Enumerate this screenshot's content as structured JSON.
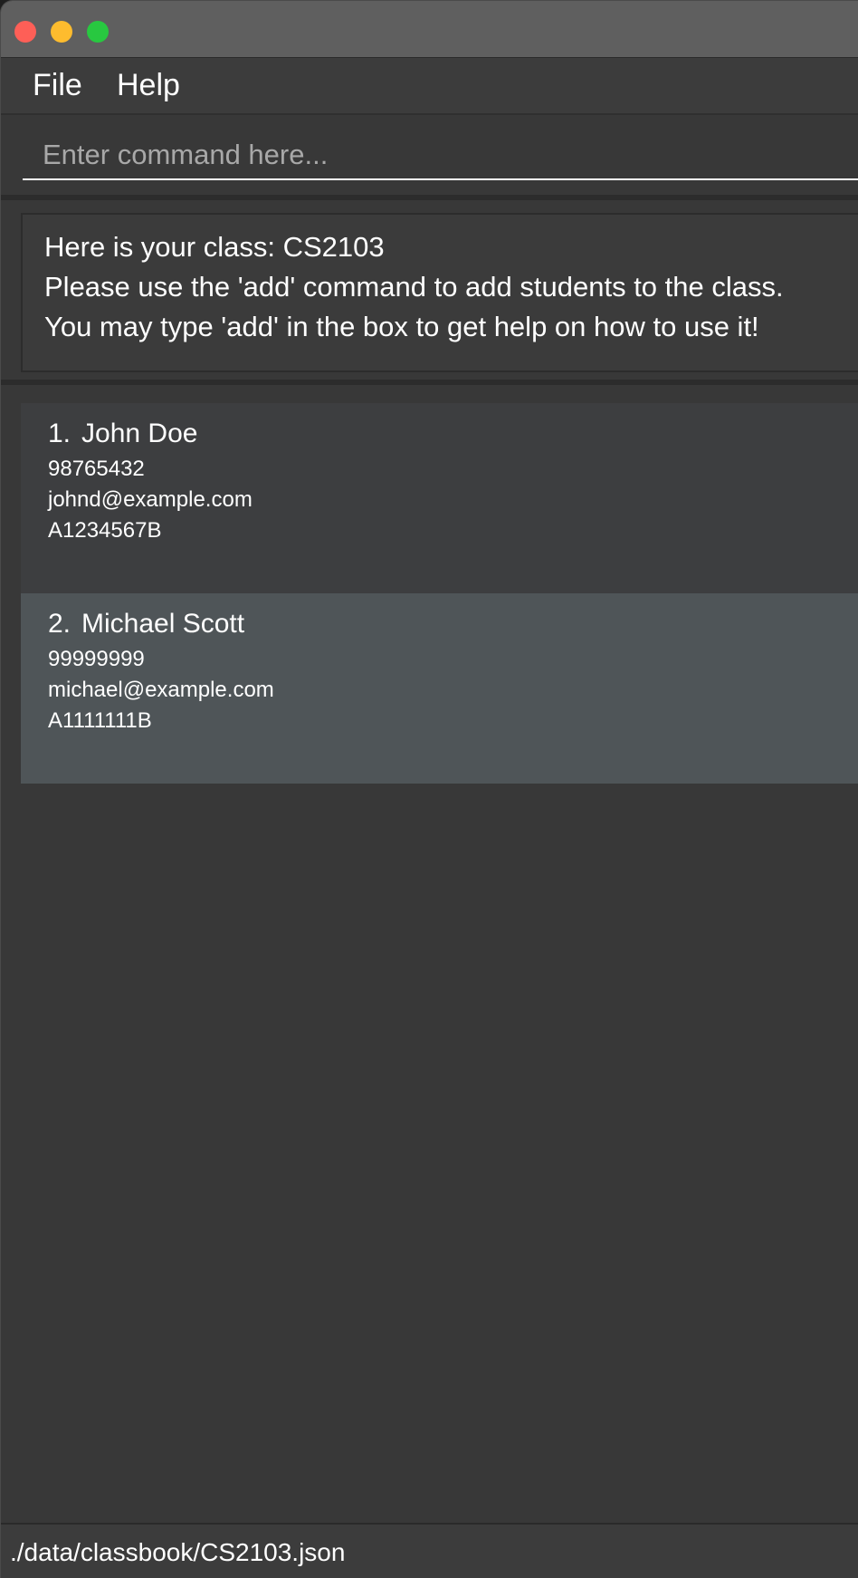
{
  "window": {
    "controls": {
      "close_color": "#fe5f57",
      "minimize_color": "#febc2e",
      "maximize_color": "#28c840"
    }
  },
  "menu": {
    "items": [
      {
        "label": "File"
      },
      {
        "label": "Help"
      }
    ]
  },
  "command": {
    "value": "",
    "placeholder": "Enter command here..."
  },
  "result": {
    "lines": [
      "Here is your class: CS2103",
      "Please use the 'add' command to add students to the class.",
      "You may type 'add' in the box to get help on how to use it!"
    ]
  },
  "students": [
    {
      "index": "1.",
      "name": "John Doe",
      "phone": "98765432",
      "email": "johnd@example.com",
      "student_id": "A1234567B"
    },
    {
      "index": "2.",
      "name": "Michael Scott",
      "phone": "99999999",
      "email": "michael@example.com",
      "student_id": "A1111111B"
    }
  ],
  "status": {
    "file_path": "./data/classbook/CS2103.json"
  }
}
